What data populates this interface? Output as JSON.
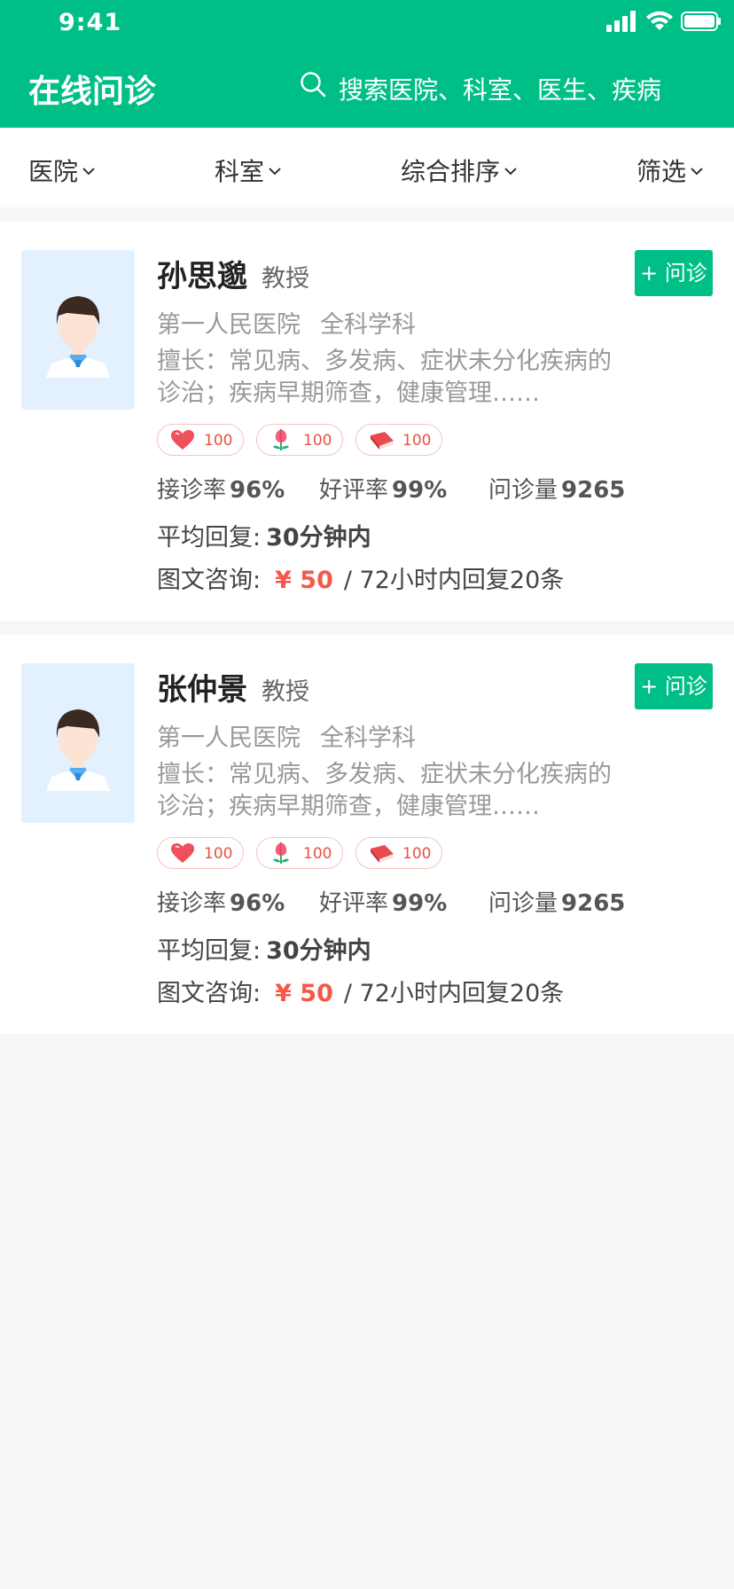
{
  "status_bar": {
    "time": "9:41",
    "icons": [
      "signal-icon",
      "wifi-icon",
      "battery-icon"
    ]
  },
  "header": {
    "title": "在线问诊",
    "search_placeholder": "搜索医院、科室、医生、疾病",
    "bg_color": "#00bf86"
  },
  "filters": [
    {
      "label": "医院"
    },
    {
      "label": "科室"
    },
    {
      "label": "综合排序"
    },
    {
      "label": "筛选"
    }
  ],
  "doctors": [
    {
      "name": "孙思邈",
      "title": "教授",
      "hospital": "第一人民医院",
      "department": "全科学科",
      "specialty": "擅长：常见病、多发病、症状未分化疾病的诊治；疾病早期筛查，健康管理……",
      "consult_label": "+ 问诊",
      "badges": [
        {
          "icon": "heart-icon",
          "count": "100"
        },
        {
          "icon": "flower-icon",
          "count": "100"
        },
        {
          "icon": "book-icon",
          "count": "100"
        }
      ],
      "stats": [
        {
          "label": "接诊率",
          "value": "96%"
        },
        {
          "label": "好评率",
          "value": "99%"
        },
        {
          "label": "问诊量",
          "value": "9265"
        }
      ],
      "reply_label": "平均回复:",
      "reply_value": "30分钟内",
      "price_label": "图文咨询:",
      "price": "¥ 50",
      "price_note": "/ 72小时内回复20条"
    },
    {
      "name": "张仲景",
      "title": "教授",
      "hospital": "第一人民医院",
      "department": "全科学科",
      "specialty": "擅长：常见病、多发病、症状未分化疾病的诊治；疾病早期筛查，健康管理……",
      "consult_label": "+ 问诊",
      "badges": [
        {
          "icon": "heart-icon",
          "count": "100"
        },
        {
          "icon": "flower-icon",
          "count": "100"
        },
        {
          "icon": "book-icon",
          "count": "100"
        }
      ],
      "stats": [
        {
          "label": "接诊率",
          "value": "96%"
        },
        {
          "label": "好评率",
          "value": "99%"
        },
        {
          "label": "问诊量",
          "value": "9265"
        }
      ],
      "reply_label": "平均回复:",
      "reply_value": "30分钟内",
      "price_label": "图文咨询:",
      "price": "¥ 50",
      "price_note": "/ 72小时内回复20条"
    }
  ]
}
